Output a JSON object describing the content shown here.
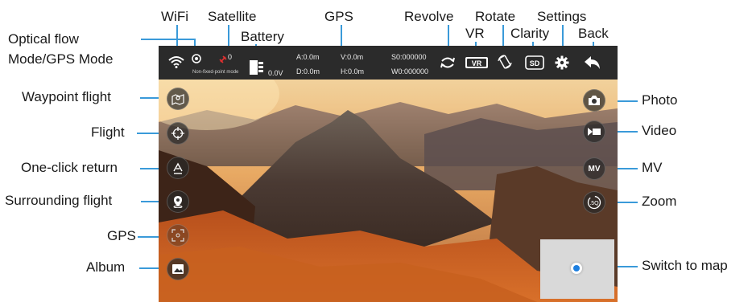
{
  "callouts_top": {
    "wifi": "WiFi",
    "satellite": "Satellite",
    "battery": "Battery",
    "gps": "GPS",
    "revolve": "Revolve",
    "vr": "VR",
    "rotate": "Rotate",
    "clarity": "Clarity",
    "settings": "Settings",
    "back": "Back"
  },
  "callouts_left": {
    "optical_flow_line1": "Optical flow",
    "optical_flow_line2": "Mode/GPS Mode",
    "waypoint": "Waypoint flight",
    "flight": "Flight",
    "one_click_return": "One-click return",
    "surrounding": "Surrounding flight",
    "gps": "GPS",
    "album": "Album"
  },
  "callouts_right": {
    "photo": "Photo",
    "video": "Video",
    "mv": "MV",
    "zoom": "Zoom",
    "switch_map": "Switch to map"
  },
  "topbar": {
    "satellite_count": "0",
    "mode_text": "Non-fixed-point mode",
    "battery_voltage": "0.0V",
    "altitude": "A:0.0m",
    "distance": "D:0.0m",
    "vertical_speed": "V:0.0m",
    "horizontal_speed": "H:0.0m",
    "s_code": "S0:000000",
    "w_code": "W0:000000",
    "vr_label": "VR",
    "clarity_label": "SD"
  },
  "buttons": {
    "mv_label": "MV",
    "zoom_label": ".5Q"
  },
  "icons": {
    "wifi": "wifi-icon",
    "mode": "target-mode-icon",
    "satellite": "satellite-icon",
    "battery": "battery-icon",
    "revolve": "revolve-icon",
    "rotate": "rotate-icon",
    "settings": "gear-icon",
    "back": "back-arrow-icon",
    "waypoint": "waypoint-map-icon",
    "flight": "crosshair-icon",
    "return": "return-home-icon",
    "surround": "location-pin-icon",
    "gps": "gps-frame-icon",
    "album": "image-icon",
    "photo": "camera-icon",
    "video": "video-camera-icon"
  },
  "colors": {
    "accent_line": "#3a9ad9",
    "topbar_bg": "#2b2b2b",
    "map_marker": "#1e7fe0",
    "satellite_red": "#e03030"
  }
}
